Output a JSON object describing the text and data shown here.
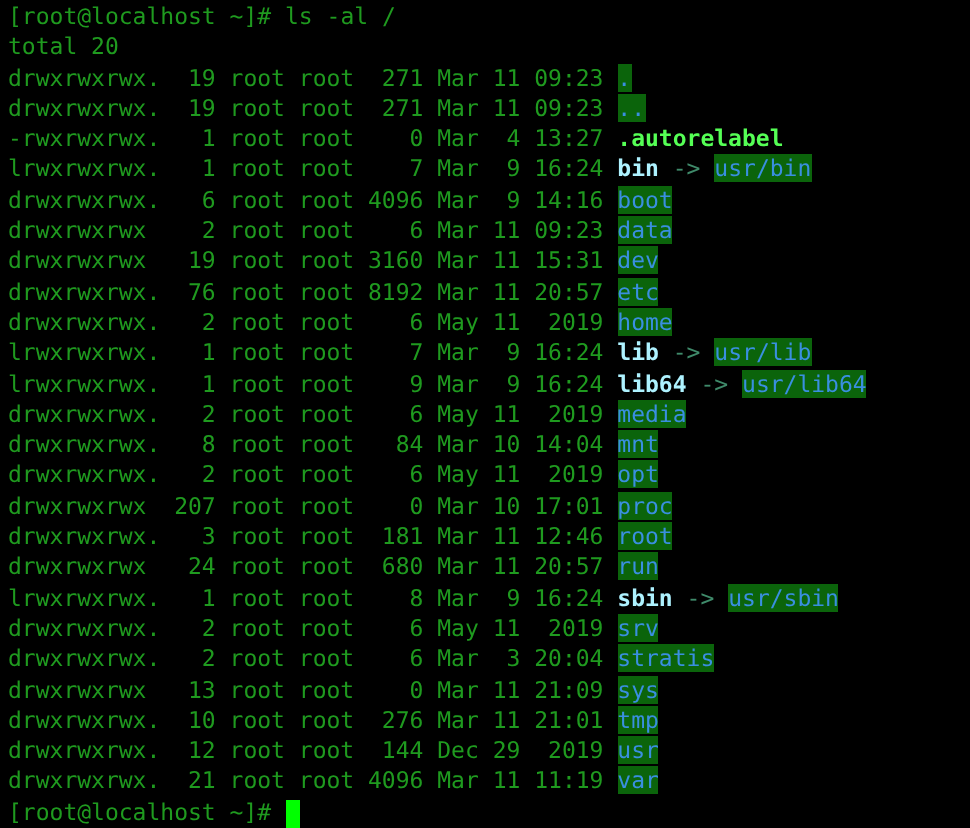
{
  "command_line": {
    "prompt": "[root@localhost ~]#",
    "command": "ls -al /"
  },
  "total": "total 20",
  "entries": [
    {
      "details": "drwxrwxrwx.  19 root root  271 Mar 11 09:23",
      "name": ".",
      "kind": "dir"
    },
    {
      "details": "drwxrwxrwx.  19 root root  271 Mar 11 09:23",
      "name": "..",
      "kind": "dir"
    },
    {
      "details": "-rwxrwxrwx.   1 root root    0 Mar  4 13:27",
      "name": ".autorelabel",
      "kind": "file"
    },
    {
      "details": "lrwxrwxrwx.   1 root root    7 Mar  9 16:24",
      "name": "bin",
      "kind": "link",
      "arrow": "->",
      "target": "usr/bin"
    },
    {
      "details": "drwxrwxrwx.   6 root root 4096 Mar  9 14:16",
      "name": "boot",
      "kind": "dir"
    },
    {
      "details": "drwxrwxrwx    2 root root    6 Mar 11 09:23",
      "name": "data",
      "kind": "dir"
    },
    {
      "details": "drwxrwxrwx   19 root root 3160 Mar 11 15:31",
      "name": "dev",
      "kind": "dir"
    },
    {
      "details": "drwxrwxrwx.  76 root root 8192 Mar 11 20:57",
      "name": "etc",
      "kind": "dir"
    },
    {
      "details": "drwxrwxrwx.   2 root root    6 May 11  2019",
      "name": "home",
      "kind": "dir"
    },
    {
      "details": "lrwxrwxrwx.   1 root root    7 Mar  9 16:24",
      "name": "lib",
      "kind": "link",
      "arrow": "->",
      "target": "usr/lib"
    },
    {
      "details": "lrwxrwxrwx.   1 root root    9 Mar  9 16:24",
      "name": "lib64",
      "kind": "link",
      "arrow": "->",
      "target": "usr/lib64"
    },
    {
      "details": "drwxrwxrwx.   2 root root    6 May 11  2019",
      "name": "media",
      "kind": "dir"
    },
    {
      "details": "drwxrwxrwx.   8 root root   84 Mar 10 14:04",
      "name": "mnt",
      "kind": "dir"
    },
    {
      "details": "drwxrwxrwx.   2 root root    6 May 11  2019",
      "name": "opt",
      "kind": "dir"
    },
    {
      "details": "drwxrwxrwx  207 root root    0 Mar 10 17:01",
      "name": "proc",
      "kind": "dir"
    },
    {
      "details": "drwxrwxrwx.   3 root root  181 Mar 11 12:46",
      "name": "root",
      "kind": "dir"
    },
    {
      "details": "drwxrwxrwx   24 root root  680 Mar 11 20:57",
      "name": "run",
      "kind": "dir"
    },
    {
      "details": "lrwxrwxrwx.   1 root root    8 Mar  9 16:24",
      "name": "sbin",
      "kind": "link",
      "arrow": "->",
      "target": "usr/sbin"
    },
    {
      "details": "drwxrwxrwx.   2 root root    6 May 11  2019",
      "name": "srv",
      "kind": "dir"
    },
    {
      "details": "drwxrwxrwx.   2 root root    6 Mar  3 20:04",
      "name": "stratis",
      "kind": "dir"
    },
    {
      "details": "drwxrwxrwx   13 root root    0 Mar 11 21:09",
      "name": "sys",
      "kind": "dir"
    },
    {
      "details": "drwxrwxrwx.  10 root root  276 Mar 11 21:01",
      "name": "tmp",
      "kind": "dir"
    },
    {
      "details": "drwxrwxrwx.  12 root root  144 Dec 29  2019",
      "name": "usr",
      "kind": "dir"
    },
    {
      "details": "drwxrwxrwx.  21 root root 4096 Mar 11 11:19",
      "name": "var",
      "kind": "dir"
    }
  ],
  "final_prompt": "[root@localhost ~]#"
}
